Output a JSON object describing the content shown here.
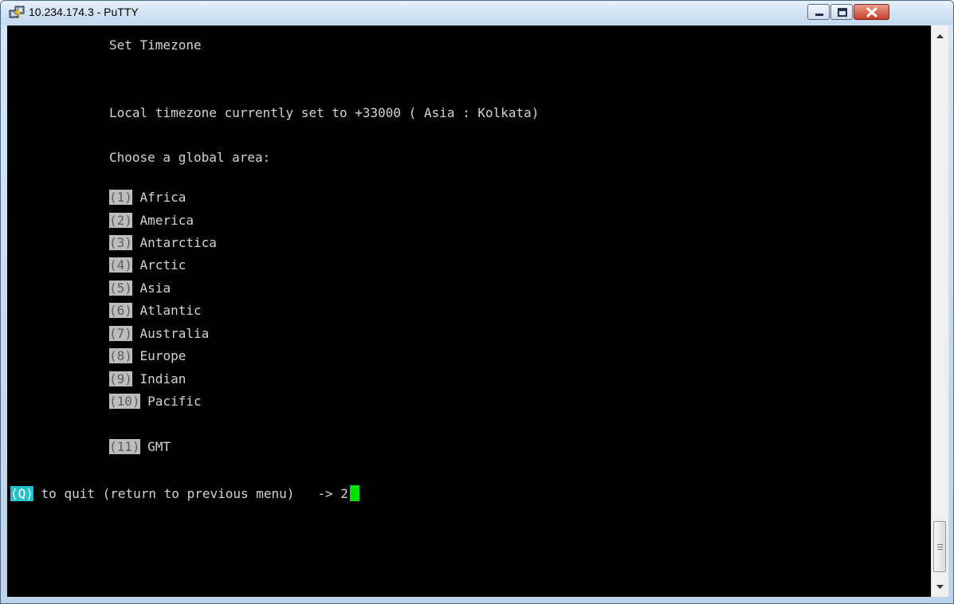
{
  "window": {
    "title": "10.234.174.3 - PuTTY"
  },
  "terminal": {
    "heading": "Set Timezone",
    "status_line": "Local timezone currently set to +33000 ( Asia : Kolkata)",
    "prompt_line": "Choose a global area:",
    "menu_items": [
      {
        "key": "(1)",
        "label": " Africa"
      },
      {
        "key": "(2)",
        "label": " America"
      },
      {
        "key": "(3)",
        "label": " Antarctica"
      },
      {
        "key": "(4)",
        "label": " Arctic"
      },
      {
        "key": "(5)",
        "label": " Asia"
      },
      {
        "key": "(6)",
        "label": " Atlantic"
      },
      {
        "key": "(7)",
        "label": " Australia"
      },
      {
        "key": "(8)",
        "label": " Europe"
      },
      {
        "key": "(9)",
        "label": " Indian"
      },
      {
        "key": "(10)",
        "label": " Pacific"
      },
      {
        "key": "(11)",
        "label": " GMT"
      }
    ],
    "quit_key": "(Q)",
    "quit_text": " to quit (return to previous menu)   -> ",
    "input_value": "2"
  },
  "colors": {
    "background": "#000000",
    "text": "#d4d4d4",
    "key_highlight": "#bdbdbd",
    "quit_highlight": "#22c1c9",
    "cursor": "#00e000"
  },
  "icons": {
    "app": "putty-icon",
    "minimize": "minimize-icon",
    "maximize": "maximize-icon",
    "close": "close-icon",
    "scroll_up": "scroll-up-arrow-icon",
    "scroll_down": "scroll-down-arrow-icon"
  }
}
